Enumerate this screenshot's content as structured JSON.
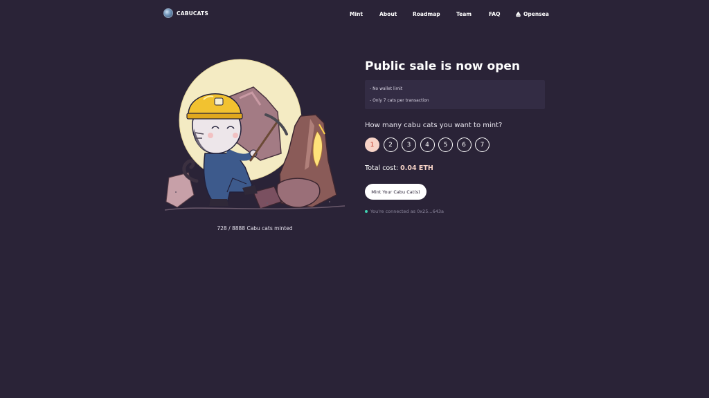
{
  "brand": {
    "name": "CABUCATS",
    "logo_icon": "planet-logo-icon"
  },
  "nav": {
    "items": [
      "Mint",
      "About",
      "Roadmap",
      "Team",
      "FAQ"
    ],
    "opensea_label": "Opensea",
    "opensea_icon": "opensea-boat-icon"
  },
  "hero": {
    "image": "miner-cat-illustration",
    "minted_text": "728 / 8888 Cabu cats minted"
  },
  "sale": {
    "title": "Public sale is now open",
    "notes": [
      "- No wallet limit",
      "- Only 7 cats per transaction"
    ],
    "question": "How many cabu cats you want to mint?",
    "quantities": [
      "1",
      "2",
      "3",
      "4",
      "5",
      "6",
      "7"
    ],
    "selected_quantity": "1",
    "total_label": "Total cost:",
    "total_value": "0.04 ETH",
    "mint_button": "Mint Your Cabu Cat(s)",
    "connected_text": "You're connected as 0x25...643a"
  },
  "colors": {
    "background": "#2a2337",
    "accent": "#f7d3c7",
    "status": "#3fd2b2"
  }
}
